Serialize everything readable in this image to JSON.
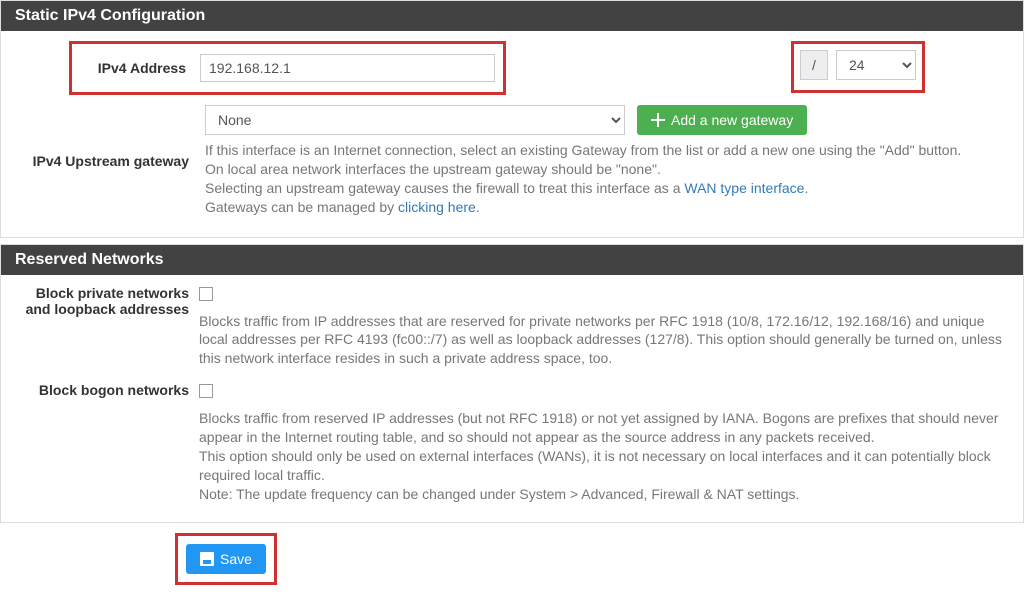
{
  "static_section": {
    "title": "Static IPv4 Configuration",
    "ipv4_label": "IPv4 Address",
    "ipv4_value": "192.168.12.1",
    "cidr_slash": "/",
    "cidr_value": "24",
    "gateway_label": "IPv4 Upstream gateway",
    "gateway_value": "None",
    "gateway_button": "Add a new gateway",
    "help_line1": "If this interface is an Internet connection, select an existing Gateway from the list or add a new one using the \"Add\" button.",
    "help_line2": "On local area network interfaces the upstream gateway should be \"none\".",
    "help_line3_a": "Selecting an upstream gateway causes the firewall to treat this interface as a ",
    "help_line3_link": "WAN type interface",
    "help_line3_b": ".",
    "help_line4_a": "Gateways can be managed by ",
    "help_line4_link": "clicking here",
    "help_line4_b": "."
  },
  "reserved_section": {
    "title": "Reserved Networks",
    "block_private_label": "Block private networks and loopback addresses",
    "block_private_desc": "Blocks traffic from IP addresses that are reserved for private networks per RFC 1918 (10/8, 172.16/12, 192.168/16) and unique local addresses per RFC 4193 (fc00::/7) as well as loopback addresses (127/8). This option should generally be turned on, unless this network interface resides in such a private address space, too.",
    "block_bogon_label": "Block bogon networks",
    "block_bogon_desc_l1": "Blocks traffic from reserved IP addresses (but not RFC 1918) or not yet assigned by IANA. Bogons are prefixes that should never appear in the Internet routing table, and so should not appear as the source address in any packets received.",
    "block_bogon_desc_l2": "This option should only be used on external interfaces (WANs), it is not necessary on local interfaces and it can potentially block required local traffic.",
    "block_bogon_desc_l3": "Note: The update frequency can be changed under System > Advanced, Firewall & NAT settings."
  },
  "actions": {
    "save": "Save"
  }
}
